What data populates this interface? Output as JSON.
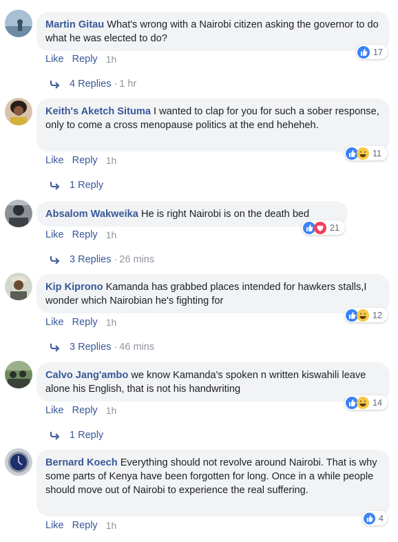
{
  "actions": {
    "like": "Like",
    "reply": "Reply"
  },
  "comments": [
    {
      "author": "Martin Gitau",
      "text": "What's wrong with a Nairobi citizen asking the governor to do what he was elected to do?",
      "time": "1h",
      "reactions": [
        "like"
      ],
      "reaction_count": "17",
      "replies_label": "4 Replies",
      "replies_time": "1 hr",
      "avatar_colors": [
        "#9fb7d0",
        "#4f6e8c"
      ]
    },
    {
      "author": "Keith's Aketch Situma",
      "text": "I wanted to clap for you for such a sober response, only to come a cross menopause politics at the end heheheh.",
      "time": "1h",
      "reactions": [
        "like",
        "haha"
      ],
      "reaction_count": "11",
      "replies_label": "1 Reply",
      "replies_time": "",
      "avatar_colors": [
        "#c7a487",
        "#3a2a24"
      ]
    },
    {
      "author": "Absalom Wakweika",
      "text": "He is right Nairobi is on the death bed",
      "time": "1h",
      "reactions": [
        "like",
        "love"
      ],
      "reaction_count": "21",
      "replies_label": "3 Replies",
      "replies_time": "26 mins",
      "avatar_colors": [
        "#7a7f86",
        "#2d3136"
      ]
    },
    {
      "author": "Kip Kiprono",
      "text": "Kamanda has grabbed places intended for hawkers stalls,I wonder which Nairobian he's fighting for",
      "time": "1h",
      "reactions": [
        "like",
        "haha"
      ],
      "reaction_count": "12",
      "replies_label": "3 Replies",
      "replies_time": "46 mins",
      "avatar_colors": [
        "#c9cfc4",
        "#5a4a3a"
      ]
    },
    {
      "author": "Calvo Jang'ambo",
      "text": "we know Kamanda's spoken n written kiswahili leave alone his English, that is not his handwriting",
      "time": "1h",
      "reactions": [
        "like",
        "haha"
      ],
      "reaction_count": "14",
      "replies_label": "1 Reply",
      "replies_time": "",
      "avatar_colors": [
        "#6f8a5f",
        "#2b2f2a"
      ]
    },
    {
      "author": "Bernard Koech",
      "text": "Everything should not revolve around Nairobi. That is why some parts of Kenya have been forgotten for long. Once in a while people should move out of Nairobi to experience the real suffering.",
      "time": "1h",
      "reactions": [
        "like"
      ],
      "reaction_count": "4",
      "replies_label": "",
      "replies_time": "",
      "avatar_colors": [
        "#2a3f7a",
        "#c8ccd4"
      ]
    }
  ],
  "colors": {
    "author": "#385898",
    "link": "#385898",
    "muted": "#90949c",
    "bubble": "#f2f3f5",
    "like_blue": "#3b82f6",
    "love_red": "#f33e58",
    "haha_yellow": "#f7c948"
  }
}
